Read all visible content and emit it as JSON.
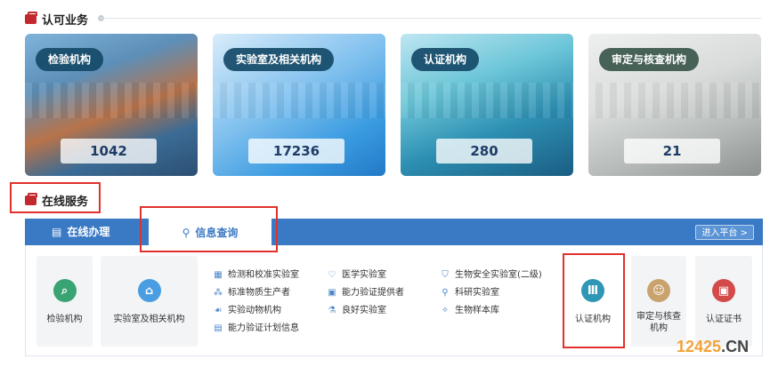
{
  "section1": {
    "title": "认可业务"
  },
  "cards": [
    {
      "label": "检验机构",
      "count": "1042"
    },
    {
      "label": "实验室及相关机构",
      "count": "17236"
    },
    {
      "label": "认证机构",
      "count": "280"
    },
    {
      "label": "审定与核查机构",
      "count": "21"
    }
  ],
  "section2": {
    "title": "在线服务"
  },
  "tabs": {
    "tab1": "在线办理",
    "tab2": "信息查询",
    "enter": "进入平台 >"
  },
  "tiles": {
    "t1": "检验机构",
    "t2": "实验室及相关机构",
    "t3": "认证机构",
    "t4": "审定与核查机构",
    "t5": "认证证书"
  },
  "list": {
    "col1": [
      "检测和校准实验室",
      "标准物质生产者",
      "实验动物机构",
      "能力验证计划信息"
    ],
    "col2": [
      "医学实验室",
      "能力验证提供者",
      "良好实验室"
    ],
    "col3": [
      "生物安全实验室(二级)",
      "科研实验室",
      "生物样本库"
    ]
  },
  "watermark": {
    "a": "12425",
    "b": ".CN"
  }
}
